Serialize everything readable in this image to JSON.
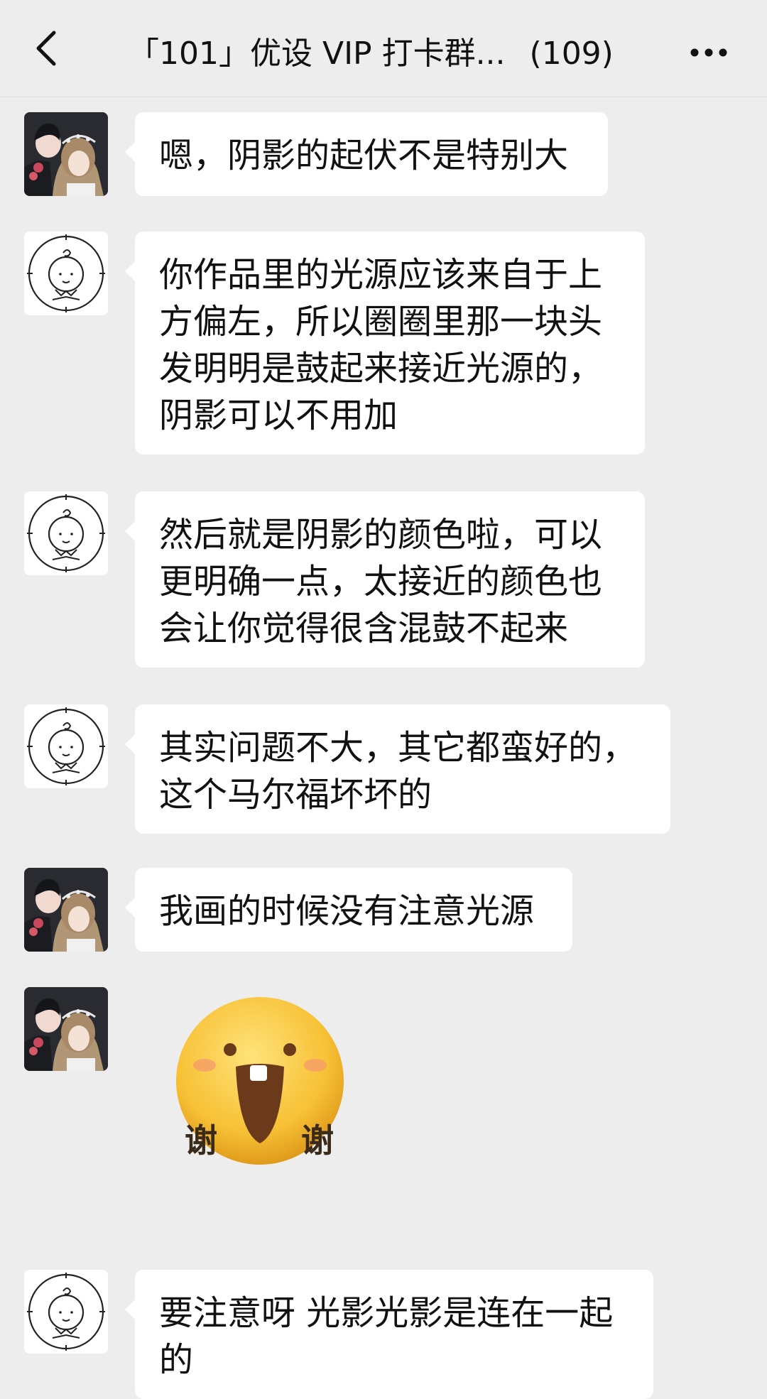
{
  "header": {
    "back_icon": "chevron-left-icon",
    "title": "「101」优设 VIP 打卡群...",
    "member_count": "(109)",
    "more_icon": "more-horizontal-icon"
  },
  "messages": [
    {
      "sender_avatar": "photo-avatar",
      "text": "嗯，阴影的起伏不是特别大"
    },
    {
      "sender_avatar": "sketch-avatar",
      "text": "你作品里的光源应该来自于上\n方偏左，所以圈圈里那一块头\n发明明是鼓起来接近光源的，\n阴影可以不用加"
    },
    {
      "sender_avatar": "sketch-avatar",
      "text": "然后就是阴影的颜色啦，可以\n更明确一点，太接近的颜色也\n会让你觉得很含混鼓不起来"
    },
    {
      "sender_avatar": "sketch-avatar",
      "text": "其实问题不大，其它都蛮好的，\n这个马尔福坏坏的"
    },
    {
      "sender_avatar": "photo-avatar",
      "text": "我画的时候没有注意光源"
    },
    {
      "sender_avatar": "photo-avatar",
      "sticker": "thanks-smiley-sticker",
      "sticker_text_left": "谢",
      "sticker_text_right": "谢"
    },
    {
      "sender_avatar": "sketch-avatar",
      "text": "要注意呀 光影光影是连在一起\n的"
    }
  ],
  "colors": {
    "background": "#ededed",
    "bubble": "#ffffff",
    "text": "#111111"
  }
}
